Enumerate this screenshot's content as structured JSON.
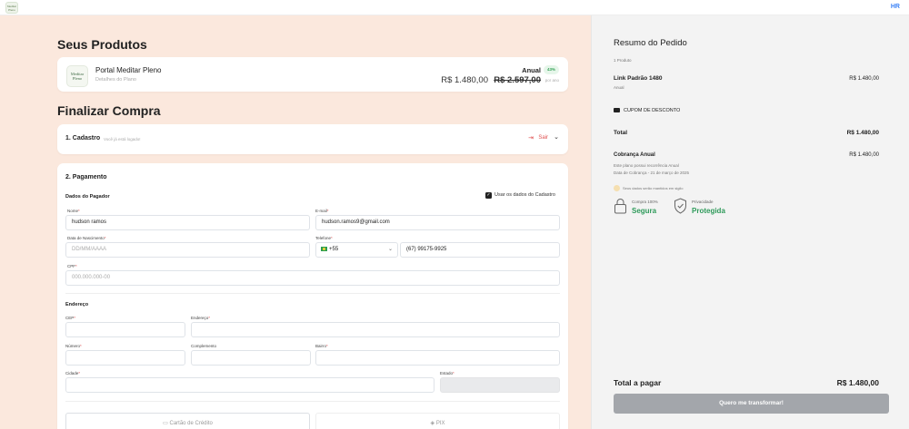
{
  "topbar": {
    "logo_text": "Meditar Pleno",
    "hr_label": "HR"
  },
  "products": {
    "title": "Seus Produtos",
    "item": {
      "thumb_line1": "Meditar",
      "thumb_line2": "Pleno",
      "name": "Portal Meditar Pleno",
      "subtitle": "Detalhes do Plano",
      "plan": "Anual",
      "discount_badge": "43%",
      "price": "R$ 1.480,00",
      "old_price": "R$ 2.597,00",
      "period": "por ano"
    }
  },
  "checkout": {
    "title": "Finalizar Compra",
    "step1": {
      "title": "1. Cadastro",
      "hint": "Você já está logado!",
      "logout_label": "Sair"
    },
    "step2": {
      "title": "2. Pagamento",
      "payer_section": "Dados do Pagador",
      "use_registration_label": "Usar os dados do Cadastro",
      "fields": {
        "name": {
          "label": "Nome",
          "value": "hudson ramos"
        },
        "email": {
          "label": "E-mail",
          "value": "hudson.ramos9@gmail.com"
        },
        "birth": {
          "label": "Data de Nascimento",
          "placeholder": "DD/MM/AAAA"
        },
        "phone": {
          "label": "Telefone",
          "country_code": "+55",
          "value": "(67) 99175-9925"
        },
        "cpf": {
          "label": "CPF",
          "placeholder": "000.000.000-00"
        }
      },
      "address_section": "Endereço",
      "address_fields": {
        "cep": "CEP",
        "street": "Endereço",
        "number": "Número",
        "complement": "Complemento",
        "district": "Bairro",
        "city": "Cidade",
        "state": "Estado"
      },
      "payment_methods": [
        "Cartão de Crédito",
        "PIX"
      ]
    }
  },
  "summary": {
    "title": "Resumo do Pedido",
    "count": "1 Produto",
    "line_name": "Link Padrão 1480",
    "line_period": "Anual",
    "line_value": "R$ 1.480,00",
    "coupon_label": "CUPOM DE DESCONTO",
    "total_label": "Total",
    "total_value": "R$ 1.480,00",
    "billing_label": "Cobrança Anual",
    "billing_value": "R$ 1.480,00",
    "billing_note": "Este plano possui recorrência Anual",
    "billing_date": "Data de Cobrança - 21 de março de 2025",
    "privacy_note": "Seus dados serão mantidos em sigilo",
    "trust_purchase_small": "Compra 100%",
    "trust_purchase_big": "Segura",
    "trust_privacy_small": "Privacidade",
    "trust_privacy_big": "Protegida",
    "pay_label": "Total a pagar",
    "pay_value": "R$ 1.480,00",
    "cta": "Quero me transformar!"
  },
  "colors": {
    "accent_green": "#2e9a5a",
    "left_bg": "#fbe8dd",
    "danger": "#e05252",
    "cta_disabled": "#a3a6ab"
  }
}
